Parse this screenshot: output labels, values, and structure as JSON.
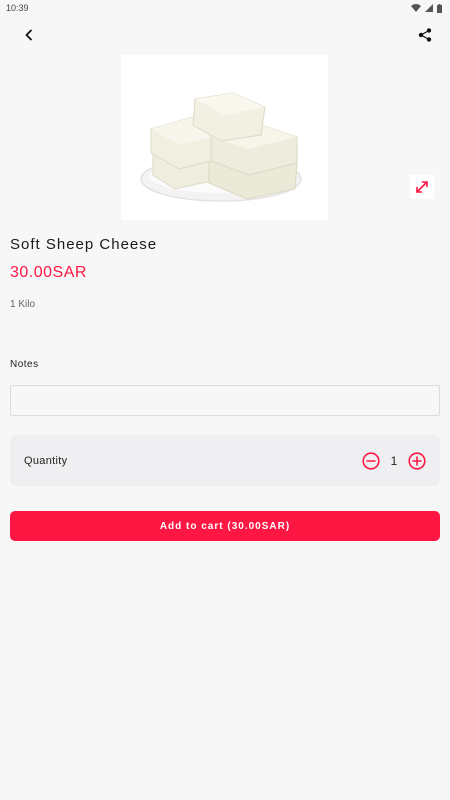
{
  "status_bar": {
    "time": "10:39"
  },
  "product": {
    "title": "Soft Sheep Cheese",
    "price": "30.00SAR",
    "unit": "1 Kilo"
  },
  "notes": {
    "label": "Notes",
    "value": "",
    "placeholder": ""
  },
  "quantity": {
    "label": "Quantity",
    "value": "1"
  },
  "cart": {
    "add_label": "Add to cart (30.00SAR)"
  },
  "icons": {
    "back": "back-arrow-icon",
    "share": "share-icon",
    "expand": "expand-icon",
    "minus": "minus-circle-icon",
    "plus": "plus-circle-icon"
  },
  "colors": {
    "accent": "#ff1744",
    "background": "#f7f7f7",
    "card": "#efeff2"
  }
}
